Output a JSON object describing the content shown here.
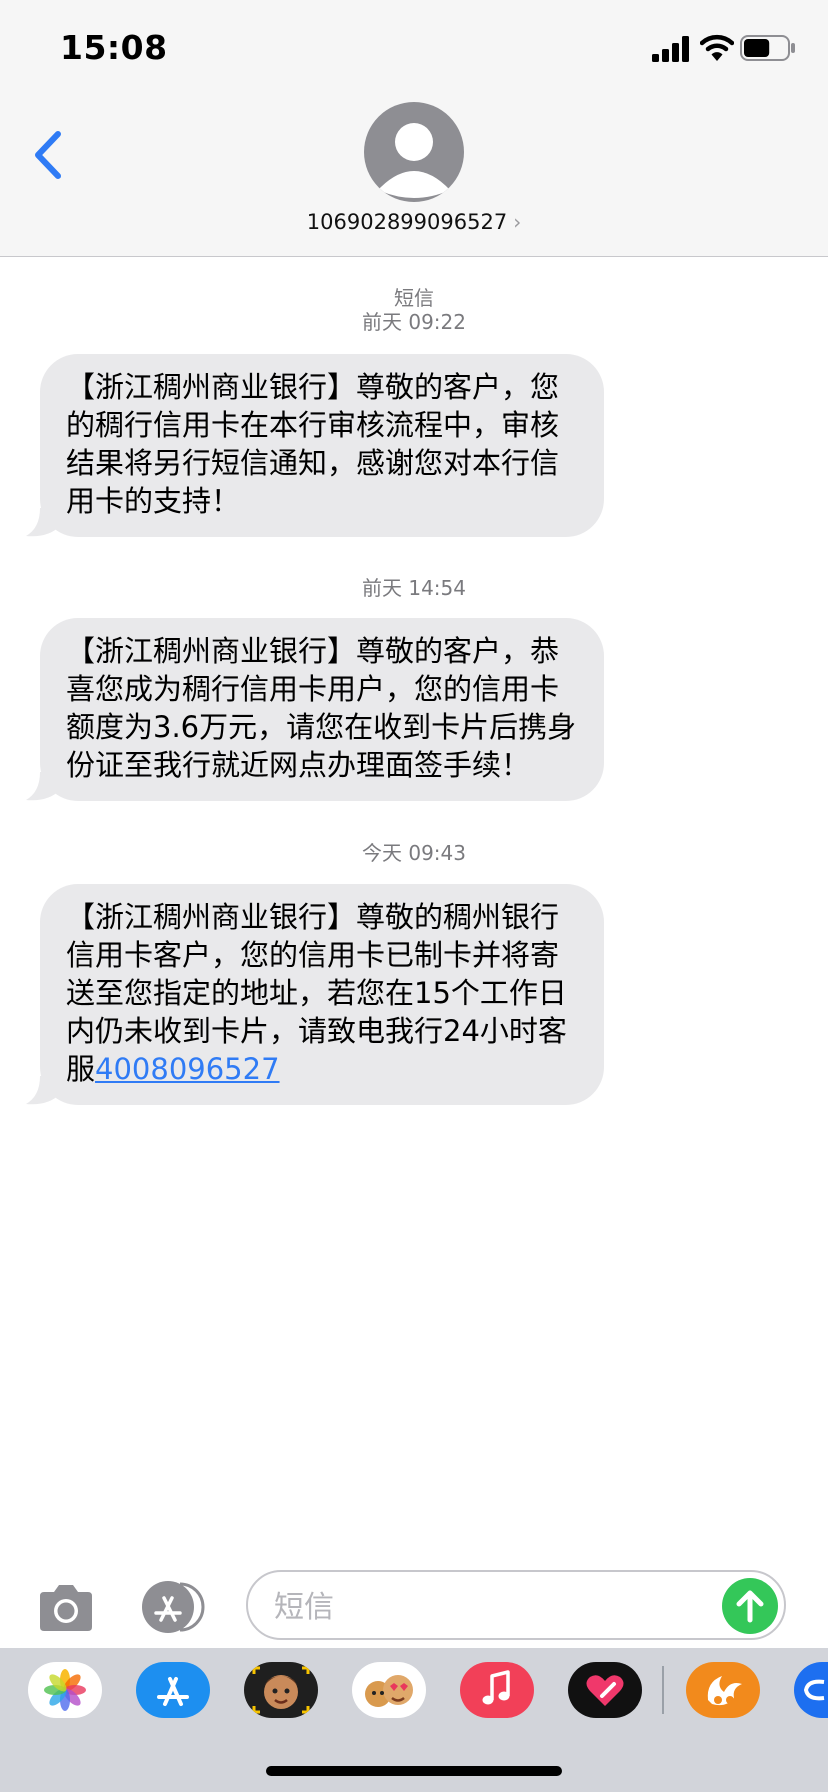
{
  "status_bar": {
    "time": "15:08",
    "battery_level": 0.6,
    "icons": [
      "cellular-signal-icon",
      "wifi-icon",
      "battery-icon"
    ]
  },
  "header": {
    "contact_number": "106902899096527",
    "back_icon": "chevron-left-icon",
    "avatar_icon": "person-icon",
    "chevron": "›"
  },
  "conversation": {
    "label": "短信",
    "messages": [
      {
        "timestamp": "前天 09:22",
        "text": "【浙江稠州商业银行】尊敬的客户，您的稠行信用卡在本行审核流程中，审核结果将另行短信通知，感谢您对本行信用卡的支持！"
      },
      {
        "timestamp": "前天 14:54",
        "text": "【浙江稠州商业银行】尊敬的客户，恭喜您成为稠行信用卡用户，您的信用卡额度为3.6万元，请您在收到卡片后携身份证至我行就近网点办理面签手续！"
      },
      {
        "timestamp": "今天 09:43",
        "text": "【浙江稠州商业银行】尊敬的稠州银行信用卡客户，您的信用卡已制卡并将寄送至您指定的地址，若您在15个工作日内仍未收到卡片，请致电我行24小时客服",
        "link": "4008096527"
      }
    ]
  },
  "input_bar": {
    "placeholder": "短信",
    "value": "",
    "camera_icon": "camera-icon",
    "apps_icon": "app-store-icon",
    "send_icon": "arrow-up-icon"
  },
  "app_drawer": {
    "apps": [
      "photos-icon",
      "app-store-icon",
      "memoji-icon",
      "animoji-icon",
      "music-icon",
      "digital-touch-icon",
      "uc-browser-icon",
      "more-apps-icon"
    ]
  },
  "colors": {
    "accent": "#2f7bf5",
    "bubble": "#e9e9eb",
    "send": "#34c759",
    "header_bg": "#f6f6f6",
    "drawer_bg": "#d2d4da"
  }
}
